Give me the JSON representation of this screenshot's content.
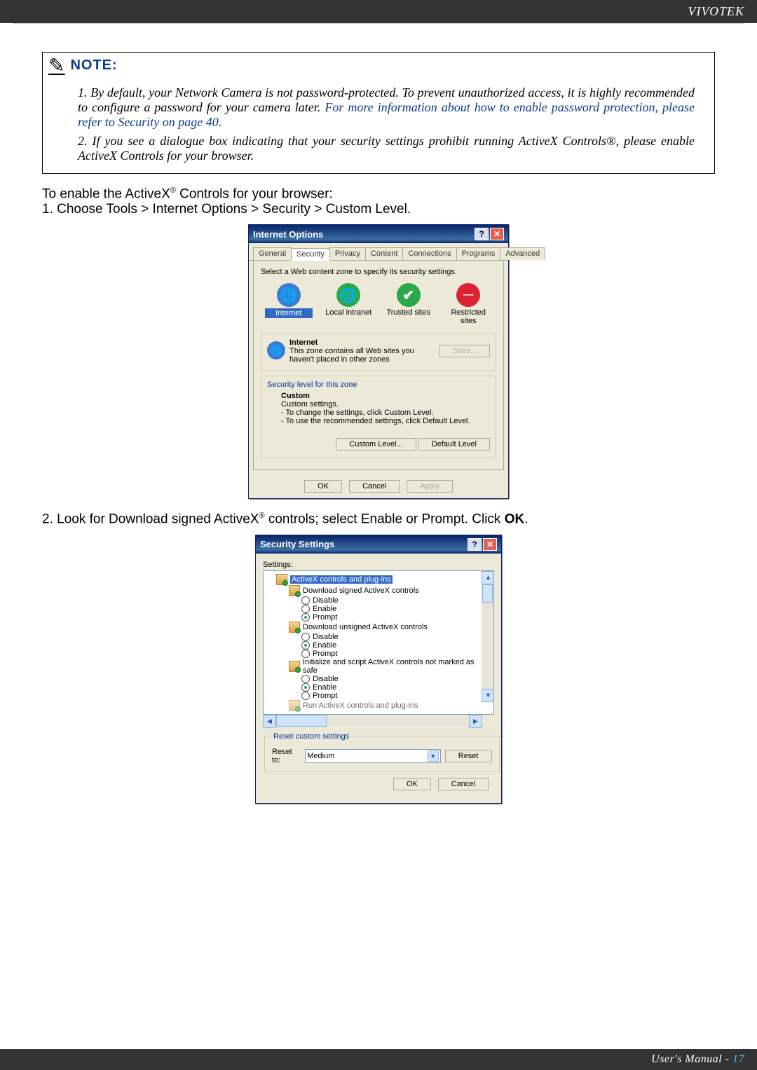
{
  "brand": "VIVOTEK",
  "note": {
    "heading": "NOTE:",
    "item1_prefix": "1. ",
    "item1_black": "By default, your Network Camera is not password-protected. To prevent unauthorized access, it is highly recommended to configure a password for your camera later. ",
    "item1_blue": "For more information about how to enable password protection, please refer to Security on page 40.",
    "item2_prefix": "2. ",
    "item2": "If you see a dialogue box indicating that your security settings prohibit running ActiveX Controls®, please enable ActiveX Controls for your browser."
  },
  "body1": {
    "line1_a": "To enable the ActiveX",
    "line1_b": " Controls for your browser:",
    "line2": "1. Choose Tools > Internet Options > Security > Custom Level.",
    "reg": "®"
  },
  "io_dialog": {
    "title": "Internet Options",
    "help": "?",
    "close": "✕",
    "tabs": [
      "General",
      "Security",
      "Privacy",
      "Content",
      "Connections",
      "Programs",
      "Advanced"
    ],
    "active_tab_index": 1,
    "instruction": "Select a Web content zone to specify its security settings.",
    "zones": [
      {
        "label": "Internet",
        "glyph": "🌐"
      },
      {
        "label": "Local intranet",
        "glyph": "🌐"
      },
      {
        "label": "Trusted sites",
        "glyph": "✔"
      },
      {
        "label": "Restricted sites",
        "glyph": "⛔"
      }
    ],
    "zone_name": "Internet",
    "zone_desc": "This zone contains all Web sites you haven't placed in other zones",
    "sites_btn": "Sites...",
    "sec_group": "Security level for this zone",
    "custom_title": "Custom",
    "custom_sub": "Custom settings.",
    "custom_line1": "- To change the settings, click Custom Level.",
    "custom_line2": "- To use the recommended settings, click Default Level.",
    "custom_level_btn": "Custom Level...",
    "default_level_btn": "Default Level",
    "ok": "OK",
    "cancel": "Cancel",
    "apply": "Apply"
  },
  "body2": {
    "a": "2. Look for Download signed ActiveX",
    "b": " controls; select Enable or Prompt. Click ",
    "ok_bold": "OK",
    "c": ".",
    "reg": "®"
  },
  "ss_dialog": {
    "title": "Security Settings",
    "help": "?",
    "close": "✕",
    "settings_label": "Settings:",
    "cat_activex": "ActiveX controls and plug-ins",
    "items": [
      {
        "label": "Download signed ActiveX controls",
        "opts": [
          "Disable",
          "Enable",
          "Prompt"
        ],
        "checked": 2
      },
      {
        "label": "Download unsigned ActiveX controls",
        "opts": [
          "Disable",
          "Enable",
          "Prompt"
        ],
        "checked": 1
      },
      {
        "label": "Initialize and script ActiveX controls not marked as safe",
        "opts": [
          "Disable",
          "Enable",
          "Prompt"
        ],
        "checked": 1
      }
    ],
    "truncated_line": "Run ActiveX controls and plug-ins",
    "reset_group": "Reset custom settings",
    "reset_to": "Reset to:",
    "reset_value": "Medium",
    "reset_btn": "Reset",
    "ok": "OK",
    "cancel": "Cancel",
    "arrows": {
      "up": "▲",
      "down": "▼",
      "left": "◀",
      "right": "▶"
    }
  },
  "footer": {
    "text": "User's Manual - ",
    "page": "17"
  }
}
